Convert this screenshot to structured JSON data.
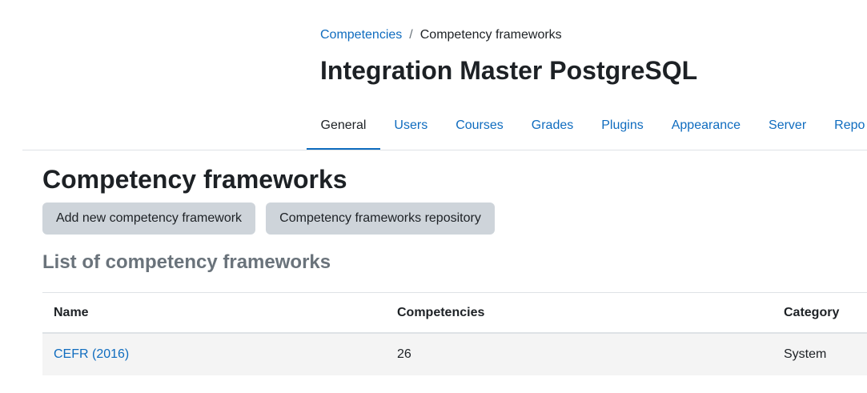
{
  "breadcrumb": {
    "items": [
      {
        "label": "Competencies"
      },
      {
        "label": "Competency frameworks"
      }
    ],
    "separator": "/"
  },
  "site": {
    "title": "Integration Master PostgreSQL"
  },
  "nav": {
    "tabs": [
      {
        "label": "General",
        "active": true
      },
      {
        "label": "Users"
      },
      {
        "label": "Courses"
      },
      {
        "label": "Grades"
      },
      {
        "label": "Plugins"
      },
      {
        "label": "Appearance"
      },
      {
        "label": "Server"
      },
      {
        "label": "Repo"
      }
    ]
  },
  "main": {
    "heading": "Competency frameworks",
    "buttons": {
      "add_label": "Add new competency framework",
      "repository_label": "Competency frameworks repository"
    },
    "list_heading": "List of competency frameworks",
    "table": {
      "columns": [
        "Name",
        "Competencies",
        "Category"
      ],
      "rows": [
        {
          "name": "CEFR (2016)",
          "competencies": "26",
          "category": "System"
        }
      ]
    }
  },
  "colors": {
    "link": "#0f6cbf",
    "text": "#1d2125",
    "muted": "#6a737b",
    "button_bg": "#ced4da",
    "row_bg": "#f4f4f4"
  }
}
